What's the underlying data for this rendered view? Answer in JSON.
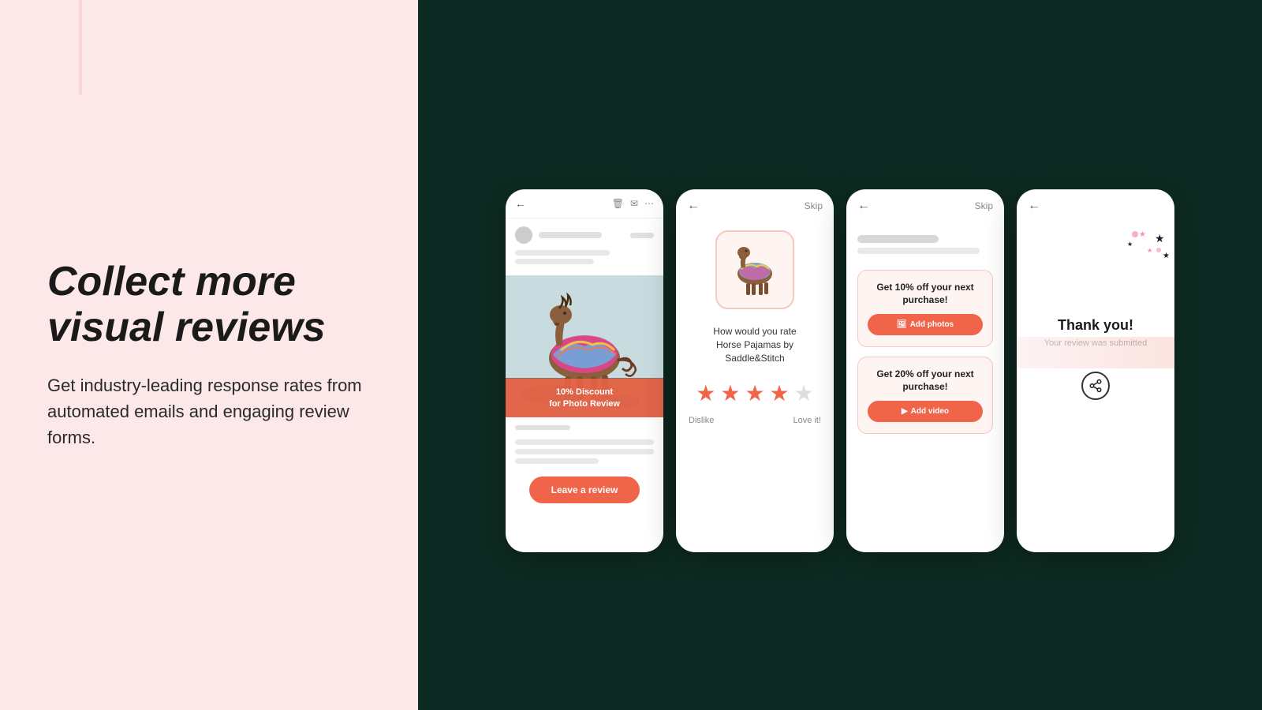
{
  "left": {
    "headline_line1": "Collect more",
    "headline_line2": "visual reviews",
    "subtext": "Get industry-leading response rates from automated emails and engaging review forms."
  },
  "phone1": {
    "discount_badge_line1": "10% Discount",
    "discount_badge_line2": "for Photo Review",
    "leave_review_btn": "Leave a review"
  },
  "phone2": {
    "skip_label": "Skip",
    "rating_question": "How would you rate\nHorse Pajamas by Saddle&Stitch",
    "dislike_label": "Dislike",
    "love_it_label": "Love it!",
    "stars": [
      true,
      true,
      true,
      true,
      false
    ]
  },
  "phone3": {
    "skip_label": "Skip",
    "offer1_text": "Get 10% off your\nnext purchase!",
    "add_photos_btn": "Add photos",
    "offer2_text": "Get 20% off your\nnext purchase!",
    "add_video_btn": "Add video"
  },
  "phone4": {
    "thank_you_title": "Thank you!",
    "submitted_text": "Your review was submitted"
  },
  "icons": {
    "back_arrow": "←",
    "trash": "🗑",
    "mail": "✉",
    "ellipsis": "⋯",
    "image": "🖼",
    "video": "🎬",
    "share": "⋯"
  }
}
